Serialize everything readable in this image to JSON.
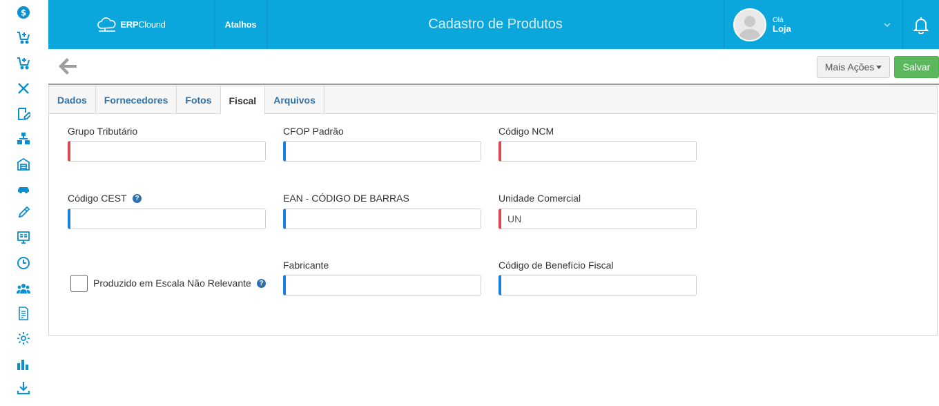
{
  "sidebar": {
    "icons": [
      "dollar-icon",
      "cart-add-icon",
      "cart-add-icon",
      "tools-icon",
      "edit-icon",
      "network-icon",
      "warehouse-icon",
      "car-icon",
      "pencil-icon",
      "monitor-icon",
      "clock-icon",
      "users-icon",
      "document-icon",
      "gear-icon",
      "bar-chart-icon",
      "download-icon"
    ]
  },
  "header": {
    "logo_bold": "ERP",
    "logo_light": "Clound",
    "shortcuts": "Atalhos",
    "title": "Cadastro de Produtos",
    "greeting": "Olá",
    "user_name": "Loja"
  },
  "actions": {
    "more_actions": "Mais Ações",
    "save": "Salvar"
  },
  "tabs": [
    "Dados",
    "Fornecedores",
    "Fotos",
    "Fiscal",
    "Arquivos"
  ],
  "active_tab": "Fiscal",
  "form": {
    "grupo_tributario": {
      "label": "Grupo Tributário",
      "value": ""
    },
    "cfop_padrao": {
      "label": "CFOP Padrão",
      "value": ""
    },
    "codigo_ncm": {
      "label": "Código NCM",
      "value": ""
    },
    "codigo_cest": {
      "label": "Código CEST",
      "value": ""
    },
    "ean": {
      "label": "EAN - CÓDIGO DE BARRAS",
      "value": ""
    },
    "unidade_comercial": {
      "label": "Unidade Comercial",
      "value": "UN"
    },
    "escala_nao_relevante": {
      "label": "Produzido em Escala Não Relevante",
      "checked": false
    },
    "fabricante": {
      "label": "Fabricante",
      "value": ""
    },
    "beneficio_fiscal": {
      "label": "Código de Benefício Fiscal",
      "value": ""
    }
  },
  "help_glyph": "?",
  "colors": {
    "header_bg": "#0ba7dc",
    "save_green": "#5cb85c",
    "required_red": "#e0464e",
    "optional_blue": "#1b7ee0",
    "tab_link": "#2f72ad"
  }
}
